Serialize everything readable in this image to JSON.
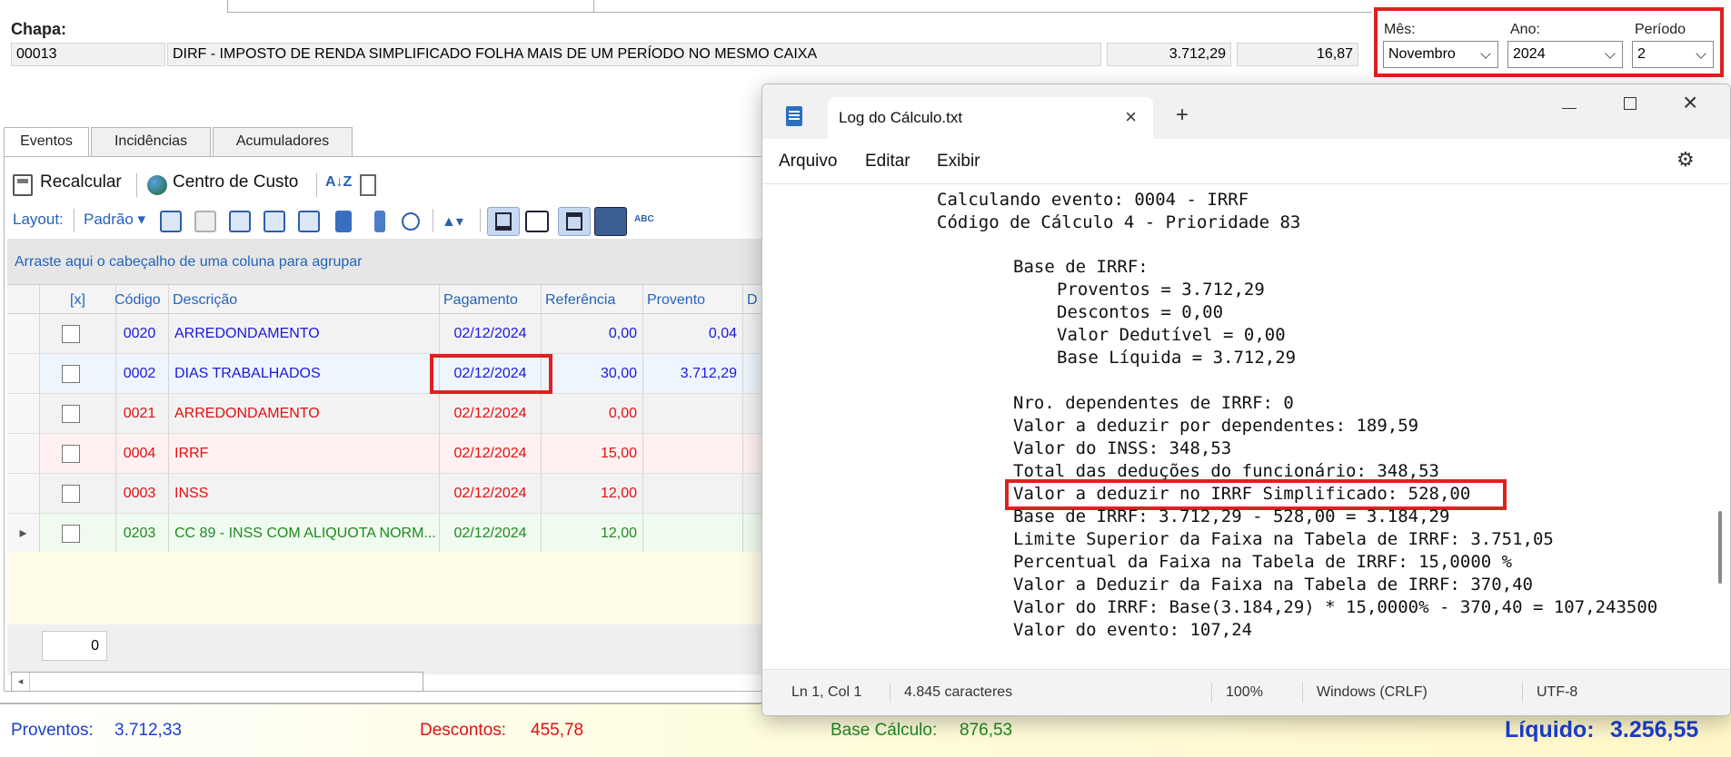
{
  "header": {
    "chapa_label": "Chapa:",
    "chapa_code": "00013",
    "description": "DIRF - IMPOSTO DE RENDA SIMPLIFICADO FOLHA MAIS DE UM PERÍODO NO MESMO CAIXA",
    "value1": "3.712,29",
    "value2": "16,87"
  },
  "period": {
    "mes_label": "Mês:",
    "mes_value": "Novembro",
    "ano_label": "Ano:",
    "ano_value": "2024",
    "periodo_label": "Período",
    "periodo_value": "2"
  },
  "tabs": [
    "Eventos",
    "Incidências",
    "Acumuladores"
  ],
  "toolbar": {
    "recalcular": "Recalcular",
    "centro_custo": "Centro de Custo",
    "layout_label": "Layout:",
    "layout_value": "Padrão"
  },
  "group_hint": "Arraste aqui o cabeçalho de uma coluna para agrupar",
  "columns": [
    "[x]",
    "Código",
    "Descrição",
    "Pagamento",
    "Referência",
    "Provento",
    "D"
  ],
  "rows": [
    {
      "codigo": "0020",
      "descricao": "ARREDONDAMENTO",
      "pagamento": "02/12/2024",
      "referencia": "0,00",
      "provento": "0,04",
      "color": "#1a1ad6",
      "bg": "#f2f2f2"
    },
    {
      "codigo": "0002",
      "descricao": "DIAS TRABALHADOS",
      "pagamento": "02/12/2024",
      "referencia": "30,00",
      "provento": "3.712,29",
      "color": "#1a1ad6",
      "bg": "#eef5fc"
    },
    {
      "codigo": "0021",
      "descricao": "ARREDONDAMENTO",
      "pagamento": "02/12/2024",
      "referencia": "0,00",
      "provento": "",
      "color": "#e01010",
      "bg": "#f2f2f2"
    },
    {
      "codigo": "0004",
      "descricao": "IRRF",
      "pagamento": "02/12/2024",
      "referencia": "15,00",
      "provento": "",
      "color": "#e01010",
      "bg": "#fff1f1"
    },
    {
      "codigo": "0003",
      "descricao": "INSS",
      "pagamento": "02/12/2024",
      "referencia": "12,00",
      "provento": "",
      "color": "#e01010",
      "bg": "#f2f2f2"
    },
    {
      "codigo": "0203",
      "descricao": "CC 89 - INSS COM ALIQUOTA NORM...",
      "pagamento": "02/12/2024",
      "referencia": "12,00",
      "provento": "",
      "color": "#1e8a1e",
      "bg": "#f0fbf0"
    }
  ],
  "counter_value": "0",
  "totals": {
    "proventos_label": "Proventos:",
    "proventos_value": "3.712,33",
    "descontos_label": "Descontos:",
    "descontos_value": "455,78",
    "base_label": "Base Cálculo:",
    "base_value": "876,53",
    "liquido_label": "Líquido:",
    "liquido_value": "3.256,55"
  },
  "notepad": {
    "tab_title": "Log do Cálculo.txt",
    "menu": [
      "Arquivo",
      "Editar",
      "Exibir"
    ],
    "lines": [
      "Calculando evento: 0004 - IRRF",
      "Código de Cálculo 4 - Prioridade 83",
      "",
      "Base de IRRF:",
      "Proventos = 3.712,29",
      "Descontos = 0,00",
      "Valor Dedutível = 0,00",
      "Base Líquida = 3.712,29",
      "",
      "Nro. dependentes de IRRF: 0",
      "Valor a deduzir por dependentes: 189,59",
      "Valor do INSS: 348,53",
      "Total das deduções do funcionário: 348,53",
      "Valor a deduzir no IRRF Simplificado: 528,00",
      "Base de IRRF: 3.712,29 - 528,00 = 3.184,29",
      "Limite Superior da Faixa na Tabela de IRRF: 3.751,05",
      "Percentual da Faixa na Tabela de IRRF: 15,0000 %",
      "Valor a Deduzir da Faixa na Tabela de IRRF: 370,40",
      "Valor do IRRF: Base(3.184,29) * 15,0000% - 370,40 = 107,243500",
      "Valor do evento: 107,24"
    ],
    "status": {
      "position": "Ln 1, Col 1",
      "chars": "4.845 caracteres",
      "zoom": "100%",
      "eol": "Windows (CRLF)",
      "encoding": "UTF-8"
    }
  }
}
